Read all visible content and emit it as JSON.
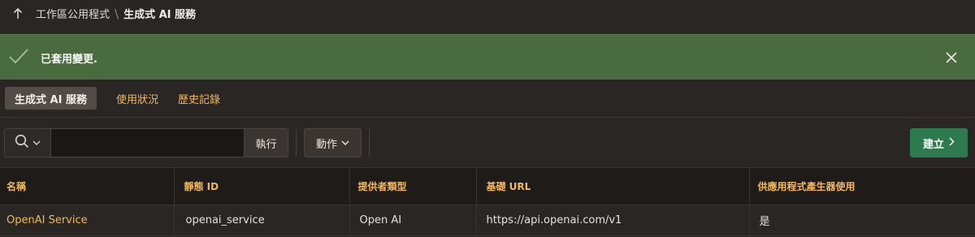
{
  "breadcrumb": {
    "parent": "工作區公用程式",
    "separator": "\\",
    "current": "生成式 AI 服務"
  },
  "banner": {
    "message": "已套用變更.",
    "color": "#4a6a3f"
  },
  "tabs": [
    {
      "label": "生成式 AI 服務",
      "active": true
    },
    {
      "label": "使用狀況",
      "active": false
    },
    {
      "label": "歷史記錄",
      "active": false
    }
  ],
  "toolbar": {
    "search_value": "",
    "search_placeholder": "",
    "go_label": "執行",
    "actions_label": "動作",
    "create_label": "建立"
  },
  "table": {
    "columns": [
      "名稱",
      "靜態 ID",
      "提供者類型",
      "基礎 URL",
      "供應用程式產生器使用"
    ],
    "rows": [
      [
        "OpenAI Service",
        "openai_service",
        "Open AI",
        "https://api.openai.com/v1",
        "是"
      ]
    ]
  },
  "colors": {
    "accent": "#f0b860",
    "create_button": "#2d7a4e",
    "background": "#2a2623"
  }
}
